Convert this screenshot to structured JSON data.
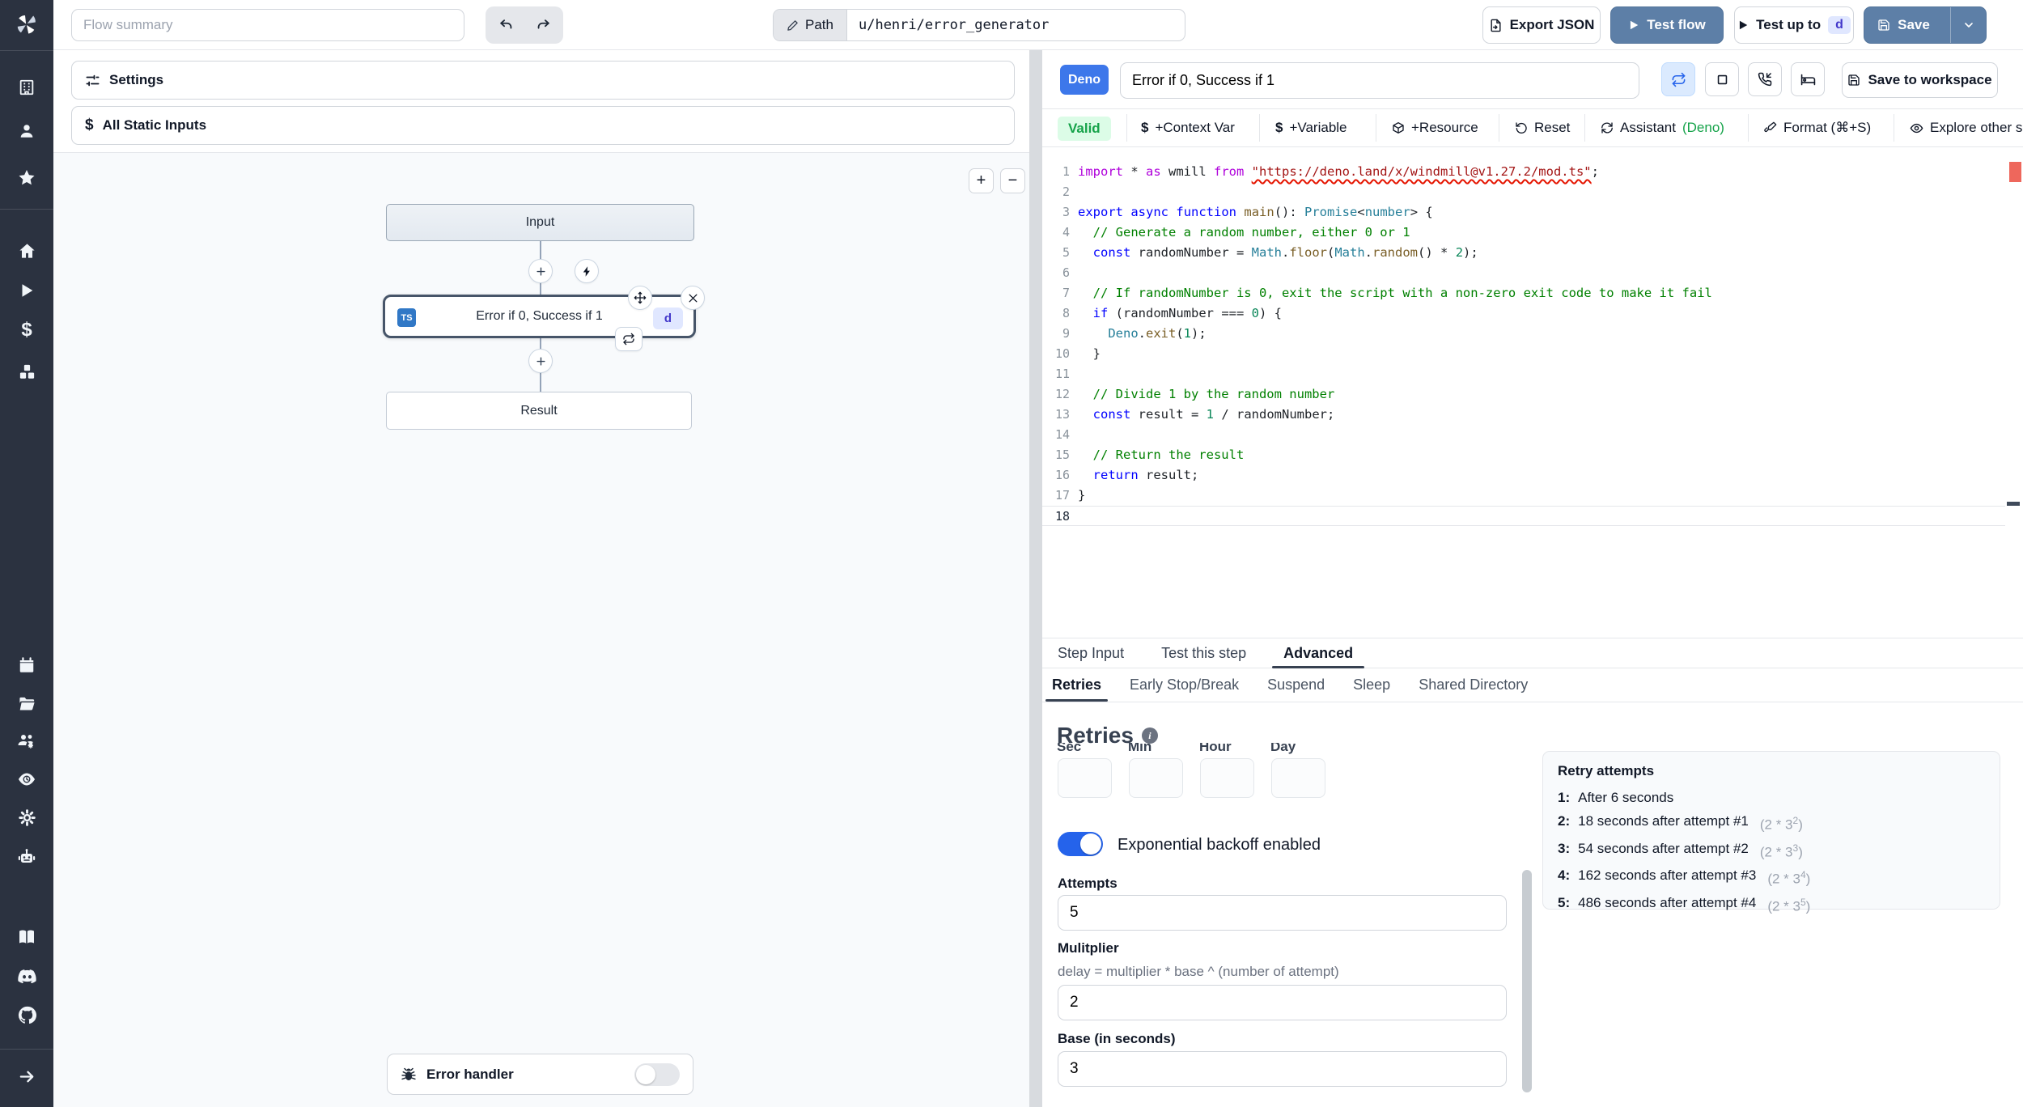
{
  "topbar": {
    "flow_summary_placeholder": "Flow summary",
    "path_label": "Path",
    "path_value": "u/henri/error_generator",
    "export_json_label": "Export JSON",
    "test_flow_label": "Test flow",
    "test_up_to_label": "Test up to",
    "test_up_to_badge": "d",
    "save_label": "Save"
  },
  "sidebar": {
    "icons": [
      "windmill-logo",
      "building",
      "user",
      "star",
      "home",
      "play",
      "dollar",
      "cubes",
      "calendar",
      "folder-open",
      "users-settings",
      "audit-eye",
      "gear",
      "robot",
      "book",
      "discord",
      "github",
      "expand-arrow"
    ]
  },
  "glyphs": {
    "dollar": "$",
    "plus": "+",
    "minus": "−",
    "info": "i"
  },
  "flow_panel": {
    "settings_label": "Settings",
    "static_inputs_label": "All Static Inputs",
    "input_node": "Input",
    "step_node": {
      "lang_badge": "TS",
      "title": "Error if 0, Success if 1",
      "id_badge": "d"
    },
    "result_node": "Result",
    "error_handler_label": "Error handler"
  },
  "editor": {
    "lang_badge": "Deno",
    "step_name": "Error if 0, Success if 1",
    "save_to_workspace_label": "Save to workspace",
    "toolbar": {
      "valid": "Valid",
      "context_var": "+Context Var",
      "variable": "+Variable",
      "resource": "+Resource",
      "reset": "Reset",
      "assistant": "Assistant",
      "assistant_lang": "(Deno)",
      "format": "Format (⌘+S)",
      "explore": "Explore other s"
    },
    "code": {
      "active_line": 18,
      "lines": [
        [
          [
            "ctrl",
            "import"
          ],
          [
            "p",
            " * "
          ],
          [
            "ctrl",
            "as"
          ],
          [
            "p",
            " wmill "
          ],
          [
            "ctrl",
            "from"
          ],
          [
            "p",
            " "
          ],
          [
            "strE",
            "\"https://deno.land/x/windmill@v1.27.2/mod.ts\""
          ],
          [
            "p",
            ";"
          ]
        ],
        [],
        [
          [
            "kw",
            "export"
          ],
          [
            "p",
            " "
          ],
          [
            "kw",
            "async"
          ],
          [
            "p",
            " "
          ],
          [
            "kw",
            "function"
          ],
          [
            "p",
            " "
          ],
          [
            "fn",
            "main"
          ],
          [
            "p",
            "(): "
          ],
          [
            "type",
            "Promise"
          ],
          [
            "p",
            "<"
          ],
          [
            "type",
            "number"
          ],
          [
            "p",
            "> {"
          ]
        ],
        [
          [
            "com",
            "  // Generate a random number, either 0 or 1"
          ]
        ],
        [
          [
            "p",
            "  "
          ],
          [
            "kw",
            "const"
          ],
          [
            "p",
            " randomNumber = "
          ],
          [
            "type",
            "Math"
          ],
          [
            "p",
            "."
          ],
          [
            "fn",
            "floor"
          ],
          [
            "p",
            "("
          ],
          [
            "type",
            "Math"
          ],
          [
            "p",
            "."
          ],
          [
            "fn",
            "random"
          ],
          [
            "p",
            "() * "
          ],
          [
            "num",
            "2"
          ],
          [
            "p",
            ");"
          ]
        ],
        [],
        [
          [
            "com",
            "  // If randomNumber is 0, exit the script with a non-zero exit code to make it fail"
          ]
        ],
        [
          [
            "p",
            "  "
          ],
          [
            "kw",
            "if"
          ],
          [
            "p",
            " (randomNumber === "
          ],
          [
            "num",
            "0"
          ],
          [
            "p",
            ") {"
          ]
        ],
        [
          [
            "p",
            "    "
          ],
          [
            "type",
            "Deno"
          ],
          [
            "p",
            "."
          ],
          [
            "fn",
            "exit"
          ],
          [
            "p",
            "("
          ],
          [
            "num",
            "1"
          ],
          [
            "p",
            ");"
          ]
        ],
        [
          [
            "p",
            "  }"
          ]
        ],
        [],
        [
          [
            "com",
            "  // Divide 1 by the random number"
          ]
        ],
        [
          [
            "p",
            "  "
          ],
          [
            "kw",
            "const"
          ],
          [
            "p",
            " result = "
          ],
          [
            "num",
            "1"
          ],
          [
            "p",
            " / randomNumber;"
          ]
        ],
        [],
        [
          [
            "com",
            "  // Return the result"
          ]
        ],
        [
          [
            "p",
            "  "
          ],
          [
            "kw",
            "return"
          ],
          [
            "p",
            " result;"
          ]
        ],
        [
          [
            "p",
            "}"
          ]
        ],
        []
      ]
    }
  },
  "panel_tabs": {
    "tabs": [
      "Step Input",
      "Test this step",
      "Advanced"
    ],
    "active_tab": "Advanced",
    "subtabs": [
      "Retries",
      "Early Stop/Break",
      "Suspend",
      "Sleep",
      "Shared Directory"
    ],
    "active_subtab": "Retries"
  },
  "retries": {
    "heading": "Retries",
    "time_labels": [
      "Sec",
      "Min",
      "Hour",
      "Day"
    ],
    "toggle_label": "Exponential backoff enabled",
    "attempts_label": "Attempts",
    "attempts_value": "5",
    "multiplier_label": "Mulitplier",
    "multiplier_help": "delay = multiplier * base ^ (number of attempt)",
    "multiplier_value": "2",
    "base_label": "Base (in seconds)",
    "base_value": "3",
    "retry_panel": {
      "title": "Retry attempts",
      "items": [
        {
          "n": "1:",
          "text": "After 6 seconds"
        },
        {
          "n": "2:",
          "text": "18 seconds after attempt #1",
          "f_pre": "(2 * 3",
          "f_exp": "2",
          "f_post": ")"
        },
        {
          "n": "3:",
          "text": "54 seconds after attempt #2",
          "f_pre": "(2 * 3",
          "f_exp": "3",
          "f_post": ")"
        },
        {
          "n": "4:",
          "text": "162 seconds after attempt #3",
          "f_pre": "(2 * 3",
          "f_exp": "4",
          "f_post": ")"
        },
        {
          "n": "5:",
          "text": "486 seconds after attempt #4",
          "f_pre": "(2 * 3",
          "f_exp": "5",
          "f_post": ")"
        }
      ]
    }
  },
  "colors": {
    "primary_button": "#5d7fa7",
    "accent_toggle": "#2563eb",
    "deno_badge": "#3d77ea",
    "valid_bg": "#dcfce7",
    "valid_text": "#16a34a",
    "ts_badge": "#3178c6",
    "sidebar_bg": "#2b3240"
  }
}
